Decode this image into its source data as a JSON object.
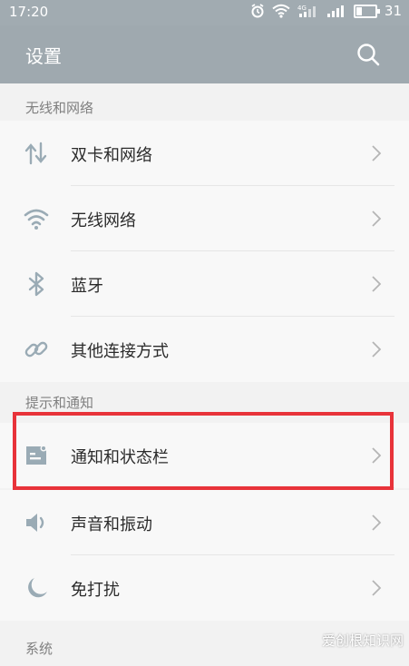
{
  "status_bar": {
    "time": "17:20",
    "battery_level": "31",
    "network": "4G"
  },
  "header": {
    "title": "设置"
  },
  "sections": [
    {
      "title": "无线和网络",
      "items": [
        {
          "label": "双卡和网络",
          "icon": "dual-sim-arrows-icon"
        },
        {
          "label": "无线网络",
          "icon": "wifi-icon"
        },
        {
          "label": "蓝牙",
          "icon": "bluetooth-icon"
        },
        {
          "label": "其他连接方式",
          "icon": "link-icon"
        }
      ]
    },
    {
      "title": "提示和通知",
      "items": [
        {
          "label": "通知和状态栏",
          "icon": "notification-card-icon",
          "highlighted": true
        },
        {
          "label": "声音和振动",
          "icon": "speaker-icon"
        },
        {
          "label": "免打扰",
          "icon": "moon-icon"
        }
      ]
    },
    {
      "title": "系统",
      "items": []
    }
  ],
  "watermark": "爱创根知识网",
  "colors": {
    "icon": "#9aabb5",
    "highlight": "#e8333a",
    "header_bg": "#9fa9af"
  }
}
